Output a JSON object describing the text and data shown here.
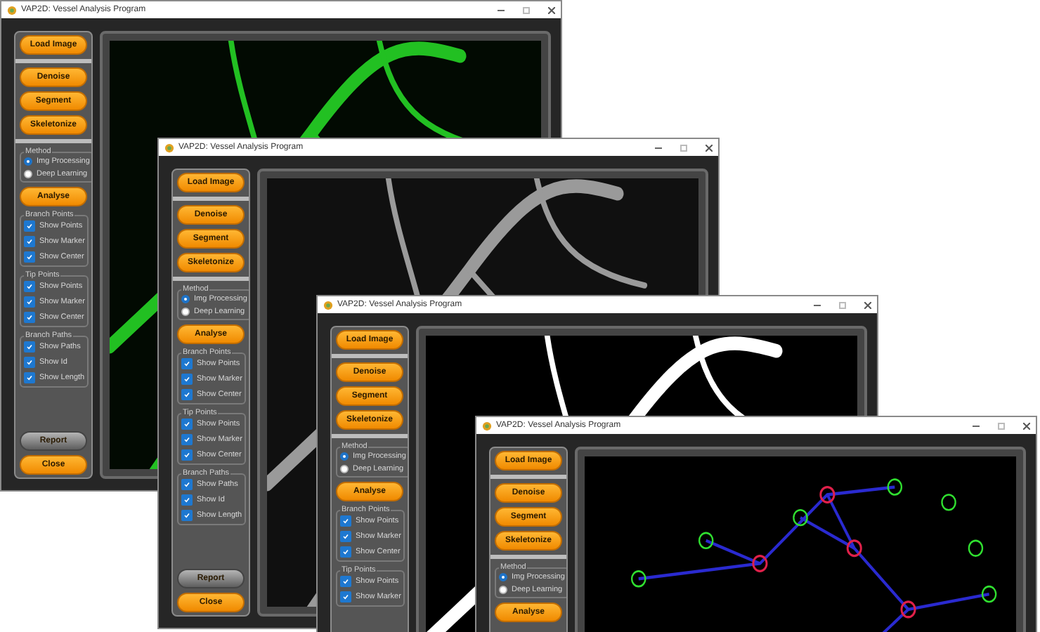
{
  "windows": [
    {
      "title": "VAP2D: Vessel Analysis Program",
      "image": {
        "kind": "fluorescence"
      },
      "top_buttons": [
        "Load Image"
      ],
      "process_buttons": [
        "Denoise",
        "Segment",
        "Skeletonize"
      ],
      "method": {
        "legend": "Method",
        "options": [
          {
            "label": "Img Processing",
            "selected": true
          },
          {
            "label": "Deep Learning",
            "selected": false
          }
        ]
      },
      "analyse_button": "Analyse",
      "sections": [
        {
          "legend": "Branch Points",
          "checkboxes": [
            {
              "label": "Show Points",
              "checked": true
            },
            {
              "label": "Show Marker",
              "checked": true
            },
            {
              "label": "Show Center",
              "checked": true
            }
          ]
        },
        {
          "legend": "Tip Points",
          "checkboxes": [
            {
              "label": "Show Points",
              "checked": true
            },
            {
              "label": "Show Marker",
              "checked": true
            },
            {
              "label": "Show Center",
              "checked": true
            }
          ]
        },
        {
          "legend": "Branch Paths",
          "checkboxes": [
            {
              "label": "Show Paths",
              "checked": true
            },
            {
              "label": "Show Id",
              "checked": true
            },
            {
              "label": "Show Length",
              "checked": true
            }
          ]
        }
      ],
      "bottom_buttons": [
        {
          "label": "Report",
          "kind": "gray"
        },
        {
          "label": "Close",
          "kind": "orange"
        }
      ]
    },
    {
      "title": "VAP2D: Vessel Analysis Program",
      "image": {
        "kind": "grayscale"
      },
      "top_buttons": [
        "Load Image"
      ],
      "process_buttons": [
        "Denoise",
        "Segment",
        "Skeletonize"
      ],
      "method": {
        "legend": "Method",
        "options": [
          {
            "label": "Img Processing",
            "selected": true
          },
          {
            "label": "Deep Learning",
            "selected": false
          }
        ]
      },
      "analyse_button": "Analyse",
      "sections": [
        {
          "legend": "Branch Points",
          "checkboxes": [
            {
              "label": "Show Points",
              "checked": true
            },
            {
              "label": "Show Marker",
              "checked": true
            },
            {
              "label": "Show Center",
              "checked": true
            }
          ]
        },
        {
          "legend": "Tip Points",
          "checkboxes": [
            {
              "label": "Show Points",
              "checked": true
            },
            {
              "label": "Show Marker",
              "checked": true
            },
            {
              "label": "Show Center",
              "checked": true
            }
          ]
        },
        {
          "legend": "Branch Paths",
          "checkboxes": [
            {
              "label": "Show Paths",
              "checked": true
            },
            {
              "label": "Show Id",
              "checked": true
            },
            {
              "label": "Show Length",
              "checked": true
            }
          ]
        }
      ],
      "bottom_buttons": [
        {
          "label": "Report",
          "kind": "gray"
        },
        {
          "label": "Close",
          "kind": "orange"
        }
      ]
    },
    {
      "title": "VAP2D: Vessel Analysis Program",
      "image": {
        "kind": "binary"
      },
      "top_buttons": [
        "Load Image"
      ],
      "process_buttons": [
        "Denoise",
        "Segment",
        "Skeletonize"
      ],
      "method": {
        "legend": "Method",
        "options": [
          {
            "label": "Img Processing",
            "selected": true
          },
          {
            "label": "Deep Learning",
            "selected": false
          }
        ]
      },
      "analyse_button": "Analyse",
      "sections": [
        {
          "legend": "Branch Points",
          "checkboxes": [
            {
              "label": "Show Points",
              "checked": true
            },
            {
              "label": "Show Marker",
              "checked": true
            },
            {
              "label": "Show Center",
              "checked": true
            }
          ]
        },
        {
          "legend": "Tip Points",
          "checkboxes": [
            {
              "label": "Show Points",
              "checked": true
            },
            {
              "label": "Show Marker",
              "checked": true
            }
          ]
        }
      ]
    },
    {
      "title": "VAP2D: Vessel Analysis Program",
      "image": {
        "kind": "skeleton"
      },
      "top_buttons": [
        "Load Image"
      ],
      "process_buttons": [
        "Denoise",
        "Segment",
        "Skeletonize"
      ],
      "method": {
        "legend": "Method",
        "options": [
          {
            "label": "Img Processing",
            "selected": true
          },
          {
            "label": "Deep Learning",
            "selected": false
          }
        ]
      },
      "analyse_button": "Analyse"
    }
  ]
}
